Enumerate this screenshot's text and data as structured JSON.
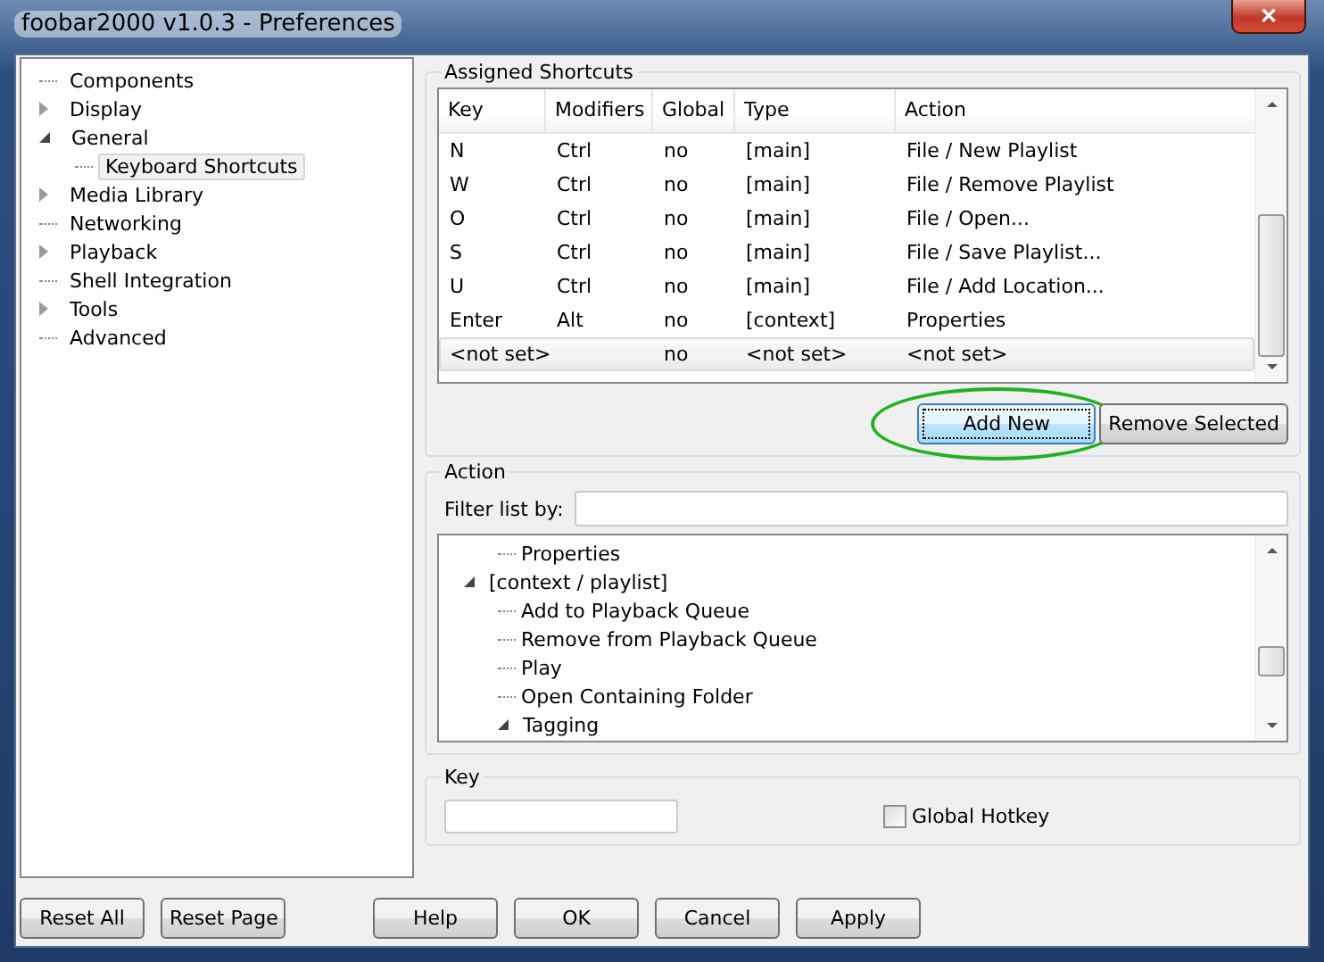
{
  "window": {
    "title": "foobar2000 v1.0.3 - Preferences",
    "close_glyph": "✕"
  },
  "sidebar": {
    "items": [
      {
        "label": "Components",
        "kind": "leaf",
        "selected": false
      },
      {
        "label": "Display",
        "kind": "folder",
        "expanded": false,
        "selected": false
      },
      {
        "label": "General",
        "kind": "folder",
        "expanded": true,
        "selected": false,
        "children": [
          {
            "label": "Keyboard Shortcuts",
            "kind": "leaf",
            "selected": true
          }
        ]
      },
      {
        "label": "Media Library",
        "kind": "folder",
        "expanded": false,
        "selected": false
      },
      {
        "label": "Networking",
        "kind": "leaf",
        "selected": false
      },
      {
        "label": "Playback",
        "kind": "folder",
        "expanded": false,
        "selected": false
      },
      {
        "label": "Shell Integration",
        "kind": "leaf",
        "selected": false
      },
      {
        "label": "Tools",
        "kind": "folder",
        "expanded": false,
        "selected": false
      },
      {
        "label": "Advanced",
        "kind": "leaf",
        "selected": false
      }
    ]
  },
  "assigned": {
    "title": "Assigned Shortcuts",
    "columns": [
      "Key",
      "Modifiers",
      "Global",
      "Type",
      "Action"
    ],
    "rows": [
      {
        "cells": [
          "N",
          "Ctrl",
          "no",
          "[main]",
          "File / New Playlist"
        ],
        "selected": false
      },
      {
        "cells": [
          "W",
          "Ctrl",
          "no",
          "[main]",
          "File / Remove Playlist"
        ],
        "selected": false
      },
      {
        "cells": [
          "O",
          "Ctrl",
          "no",
          "[main]",
          "File / Open..."
        ],
        "selected": false
      },
      {
        "cells": [
          "S",
          "Ctrl",
          "no",
          "[main]",
          "File / Save Playlist..."
        ],
        "selected": false
      },
      {
        "cells": [
          "U",
          "Ctrl",
          "no",
          "[main]",
          "File / Add Location..."
        ],
        "selected": false
      },
      {
        "cells": [
          "Enter",
          "Alt",
          "no",
          "[context]",
          "Properties"
        ],
        "selected": false
      },
      {
        "cells": [
          "<not set>",
          "",
          "no",
          "<not set>",
          "<not set>"
        ],
        "selected": true
      }
    ],
    "buttons": [
      {
        "label": "Add New",
        "highlighted": true
      },
      {
        "label": "Remove Selected",
        "highlighted": false
      }
    ]
  },
  "action": {
    "title": "Action",
    "filter_label": "Filter list by:",
    "tree": [
      {
        "kind": "offscreen",
        "children": [
          {
            "label": "Properties",
            "kind": "leaf"
          }
        ]
      },
      {
        "label": "[context / playlist]",
        "kind": "folder",
        "expanded": true,
        "children": [
          {
            "label": "Add to Playback Queue",
            "kind": "leaf"
          },
          {
            "label": "Remove from Playback Queue",
            "kind": "leaf"
          },
          {
            "label": "Play",
            "kind": "leaf"
          },
          {
            "label": "Open Containing Folder",
            "kind": "leaf"
          },
          {
            "label": "Tagging",
            "kind": "folder",
            "expanded": true
          }
        ]
      }
    ]
  },
  "key": {
    "title": "Key",
    "global_hotkey": {
      "label": "Global Hotkey",
      "checked": false
    }
  },
  "buttons": [
    "Reset All",
    "Reset Page",
    "Help",
    "OK",
    "Cancel",
    "Apply"
  ]
}
